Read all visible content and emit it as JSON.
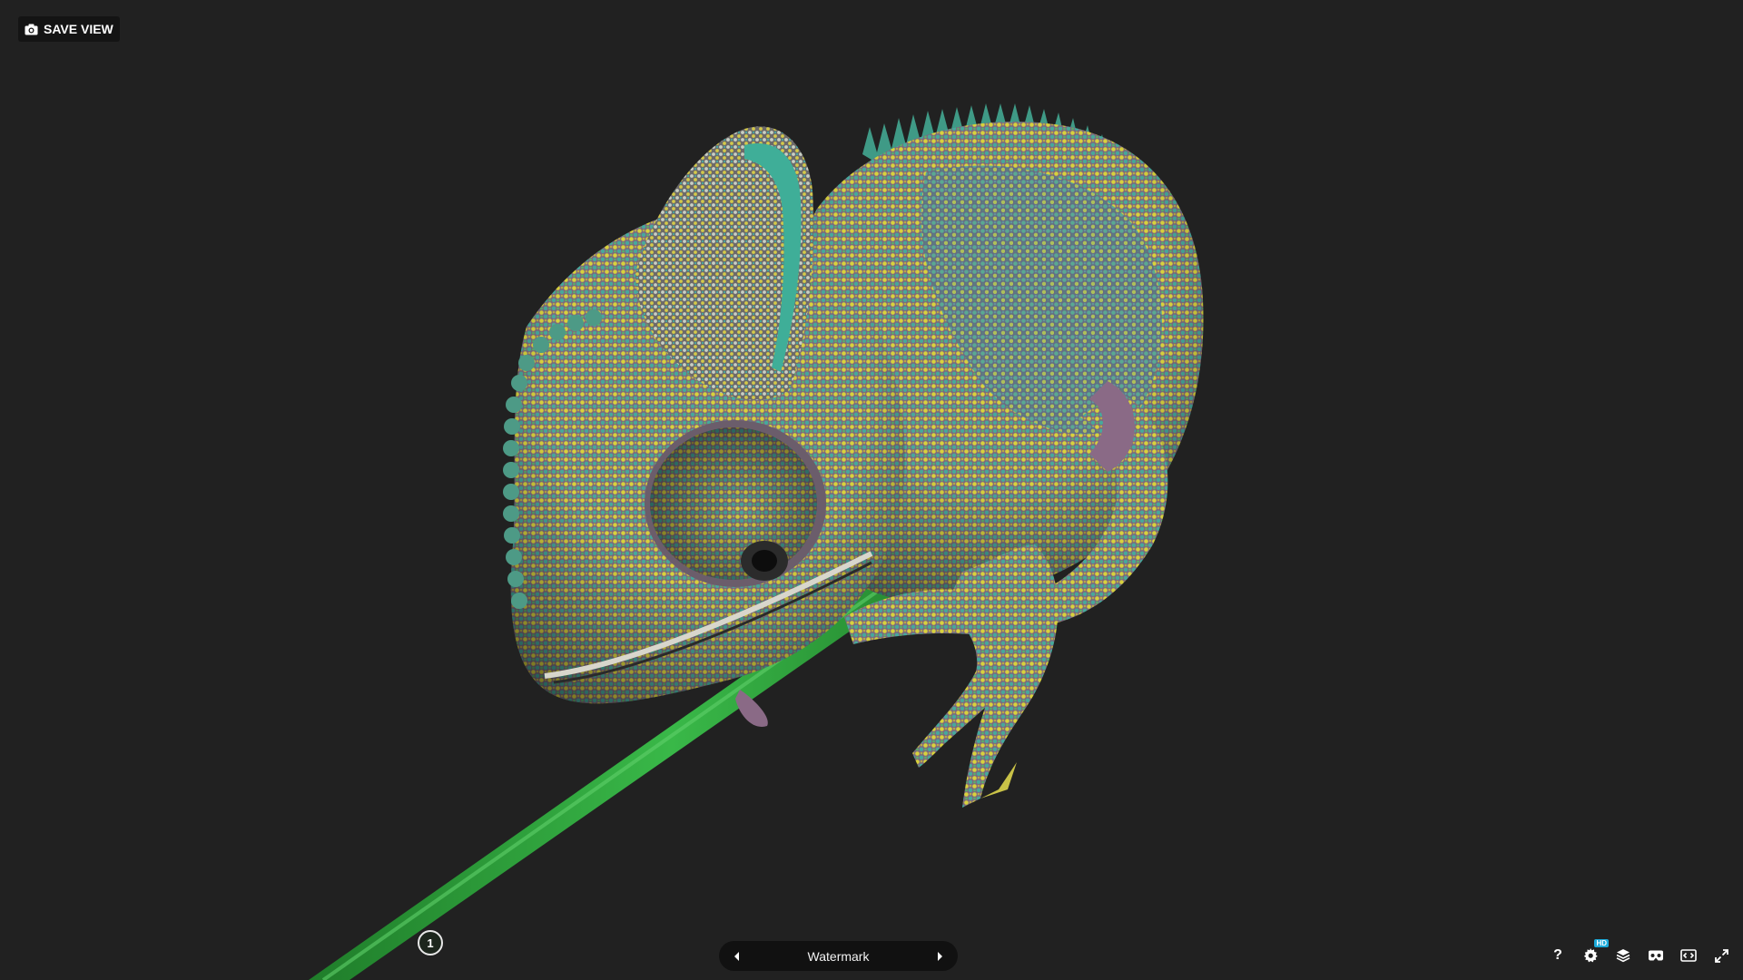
{
  "toolbar_top": {
    "save_view_label": "SAVE VIEW",
    "save_view_icon": "camera-icon"
  },
  "annotation": {
    "number": "1",
    "title": "Watermark",
    "prev_icon": "chevron-left-icon",
    "next_icon": "chevron-right-icon"
  },
  "toolbar_bottom": {
    "help_glyph": "?",
    "hd_badge": "HD",
    "icons": [
      "help-icon",
      "settings-icon",
      "layers-icon",
      "vr-headset-icon",
      "embed-icon",
      "fullscreen-icon"
    ]
  },
  "colors": {
    "background": "#212121",
    "button_bg": "#141414",
    "hd_badge": "#1caad9",
    "branch_green": "#2aa33a",
    "skin_yellow": "#d9d23a",
    "skin_teal": "#3aa8a0",
    "skin_purple": "#8a6a86"
  }
}
